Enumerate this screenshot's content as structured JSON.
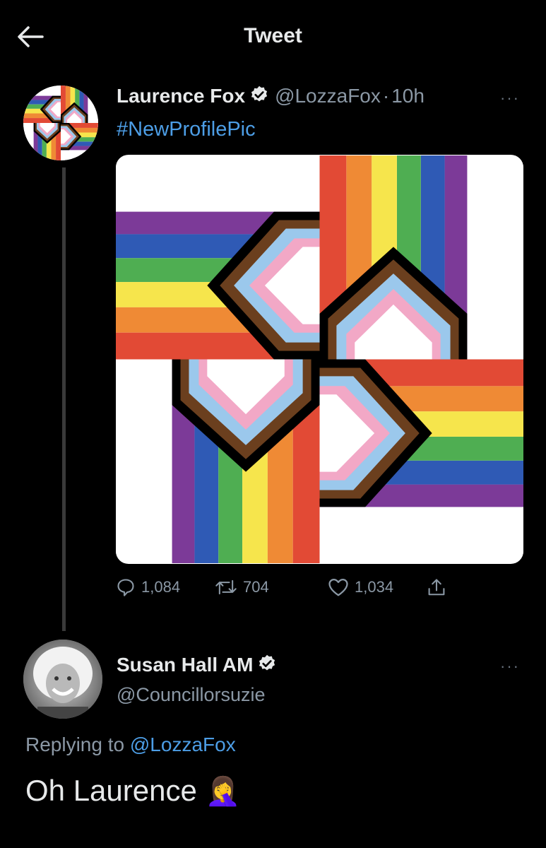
{
  "header": {
    "title": "Tweet",
    "back_icon": "arrow-left-icon"
  },
  "tweet": {
    "author_name": "Laurence Fox",
    "handle": "@LozzaFox",
    "separator": "·",
    "time": "10h",
    "text": "#NewProfilePic",
    "more": "···",
    "stats": {
      "replies": "1,084",
      "retweets": "704",
      "likes": "1,034"
    }
  },
  "reply": {
    "author_name": "Susan Hall AM",
    "handle": "@Councillorsuzie",
    "more": "···",
    "replying_prefix": "Replying to ",
    "replying_to": "@LozzaFox",
    "text": "Oh Laurence",
    "emoji": "🤦‍♀️"
  },
  "colors": {
    "background": "#000000",
    "link": "#4d9ee6",
    "muted": "#8b98a5",
    "verified": "#e7e9ea",
    "stripes": [
      "#e24a35",
      "#ef8a35",
      "#f6e54c",
      "#4fae52",
      "#2f5ab5",
      "#7c3a98"
    ],
    "chevrons": [
      "#000000",
      "#6b3f1e",
      "#9bc8ec",
      "#f2a8c6",
      "#ffffff"
    ]
  }
}
